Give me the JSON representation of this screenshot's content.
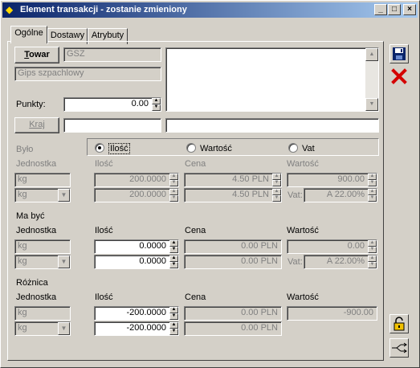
{
  "window": {
    "title": "Element transakcji - zostanie zmieniony",
    "minimize_icon": "_",
    "maximize_icon": "□",
    "close_icon": "×"
  },
  "tabs": [
    {
      "label": "Ogólne",
      "active": true
    },
    {
      "label": "Dostawy",
      "active": false
    },
    {
      "label": "Atrybuty",
      "active": false
    }
  ],
  "top": {
    "towar_button": "Towar",
    "towar_code": "GSZ",
    "towar_name": "Gips szpachlowy",
    "punkty_label": "Punkty:",
    "punkty_value": "0.00",
    "kraj_button": "Kraj",
    "kraj_value": "",
    "extra_value": ""
  },
  "bylo": {
    "label": "Było",
    "radio_ilosc": "Ilość",
    "radio_wartosc": "Wartość",
    "radio_vat": "Vat",
    "selected": "Ilość",
    "h_jednostka": "Jednostka",
    "h_ilosc": "Ilość",
    "h_cena": "Cena",
    "h_wartosc": "Wartość",
    "jm1": "kg",
    "jm2": "kg",
    "ilosc1": "200.0000",
    "ilosc2": "200.0000",
    "cena1": "4.50 PLN",
    "cena2": "4.50 PLN",
    "wartosc": "900.00",
    "vat_label": "Vat:",
    "vat_value": "A 22.00%"
  },
  "ma_byc": {
    "label": "Ma być",
    "h_jednostka": "Jednostka",
    "h_ilosc": "Ilość",
    "h_cena": "Cena",
    "h_wartosc": "Wartość",
    "jm1": "kg",
    "jm2": "kg",
    "ilosc1": "0.0000",
    "ilosc2": "0.0000",
    "cena1": "0.00 PLN",
    "cena2": "0.00 PLN",
    "wartosc": "0.00",
    "vat_label": "Vat:",
    "vat_value": "A 22.00%"
  },
  "roznica": {
    "label": "Różnica",
    "h_jednostka": "Jednostka",
    "h_ilosc": "Ilość",
    "h_cena": "Cena",
    "h_wartosc": "Wartość",
    "jm1": "kg",
    "jm2": "kg",
    "ilosc1": "-200.0000",
    "ilosc2": "-200.0000",
    "cena1": "0.00 PLN",
    "cena2": "0.00 PLN",
    "wartosc": "-900.00"
  },
  "icons": {
    "save": "floppy-disk-icon",
    "cancel": "red-x-icon",
    "unlock": "padlock-icon",
    "split": "split-arrow-icon"
  },
  "colors": {
    "title_start": "#0a246a",
    "title_end": "#a6caf0",
    "face": "#d4d0c8",
    "cancel_red": "#d40000"
  }
}
